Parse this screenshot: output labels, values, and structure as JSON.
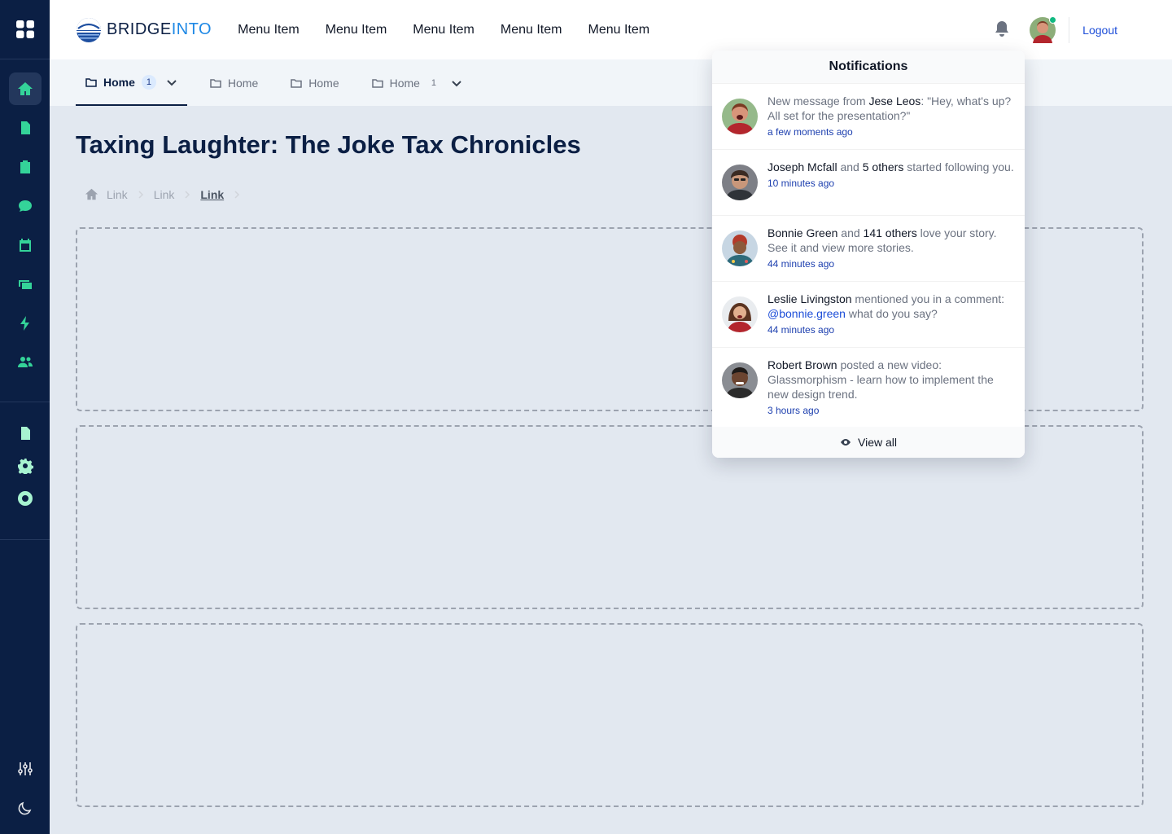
{
  "brand": {
    "name_part1": "BRIDGE",
    "name_part2": "INTO"
  },
  "topnav": {
    "menu": [
      "Menu Item",
      "Menu Item",
      "Menu Item",
      "Menu Item",
      "Menu Item"
    ],
    "logout_label": "Logout"
  },
  "tabs": [
    {
      "label": "Home",
      "count": "1",
      "active": true
    },
    {
      "label": "Home"
    },
    {
      "label": "Home"
    },
    {
      "label": "Home",
      "count": "1"
    }
  ],
  "page": {
    "title": "Taxing Laughter: The Joke Tax Chronicles"
  },
  "breadcrumb": [
    "Link",
    "Link",
    "Link"
  ],
  "notifications": {
    "title": "Notifications",
    "items": [
      {
        "prefix": "New message from ",
        "name": "Jese Leos",
        "suffix": ": \"Hey, what's up? All set for the presentation?\"",
        "time": "a few moments ago"
      },
      {
        "name": "Joseph Mcfall",
        "mid": " and ",
        "name2": "5 others",
        "suffix": " started following you.",
        "time": "10 minutes ago"
      },
      {
        "name": "Bonnie Green",
        "mid": " and ",
        "name2": "141 others",
        "suffix": "  love your story. See it and view more stories.",
        "time": "44 minutes ago"
      },
      {
        "name": "Leslie Livingston",
        "mid": "  mentioned you in a comment: ",
        "mention": "@bonnie.green",
        "suffix": " what do you say?",
        "time": "44 minutes ago"
      },
      {
        "name": "Robert Brown",
        "suffix": " posted a new video: Glassmorphism - learn how to implement the new design trend.",
        "time": "3 hours ago"
      }
    ],
    "view_all_label": "View all"
  },
  "colors": {
    "sidebar": "#0b1f44",
    "accent": "#34d399",
    "link": "#1d4ed8"
  }
}
